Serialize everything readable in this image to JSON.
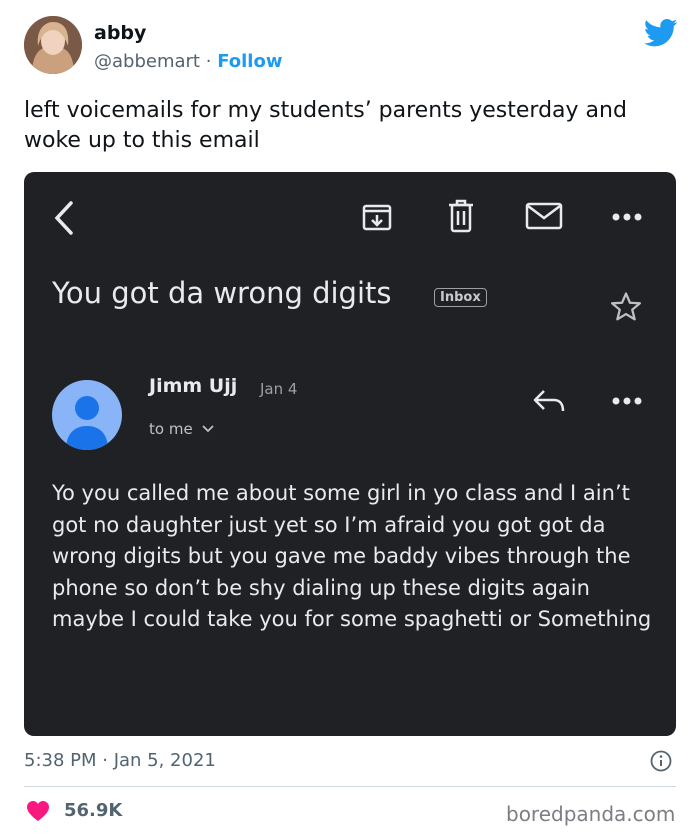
{
  "tweet": {
    "author_name": "abby",
    "author_handle": "@abbemart",
    "separator": "·",
    "follow_label": "Follow",
    "text": "left voicemails for my students’ parents yesterday and woke up to this email",
    "timestamp": "5:38 PM · Jan 5, 2021",
    "likes": "56.9K",
    "watermark": "boredpanda.com",
    "colors": {
      "accent": "#1d9bf0",
      "heart": "#f91880",
      "email_bg": "#202124"
    }
  },
  "email": {
    "subject": "You got da wrong digits",
    "label": "Inbox",
    "sender": "Jimm Ujj",
    "date": "Jan 4",
    "recipient": "to me",
    "body": "Yo you called me about some girl in yo class and I ain’t got no daughter just yet so I’m afraid you got got da wrong digits but you gave me baddy vibes through the phone so don’t be shy dialing up these digits again maybe I could take you for some spaghetti or Something",
    "toolbar_icons": [
      "back-icon",
      "archive-icon",
      "trash-icon",
      "mail-icon",
      "more-icon"
    ]
  }
}
